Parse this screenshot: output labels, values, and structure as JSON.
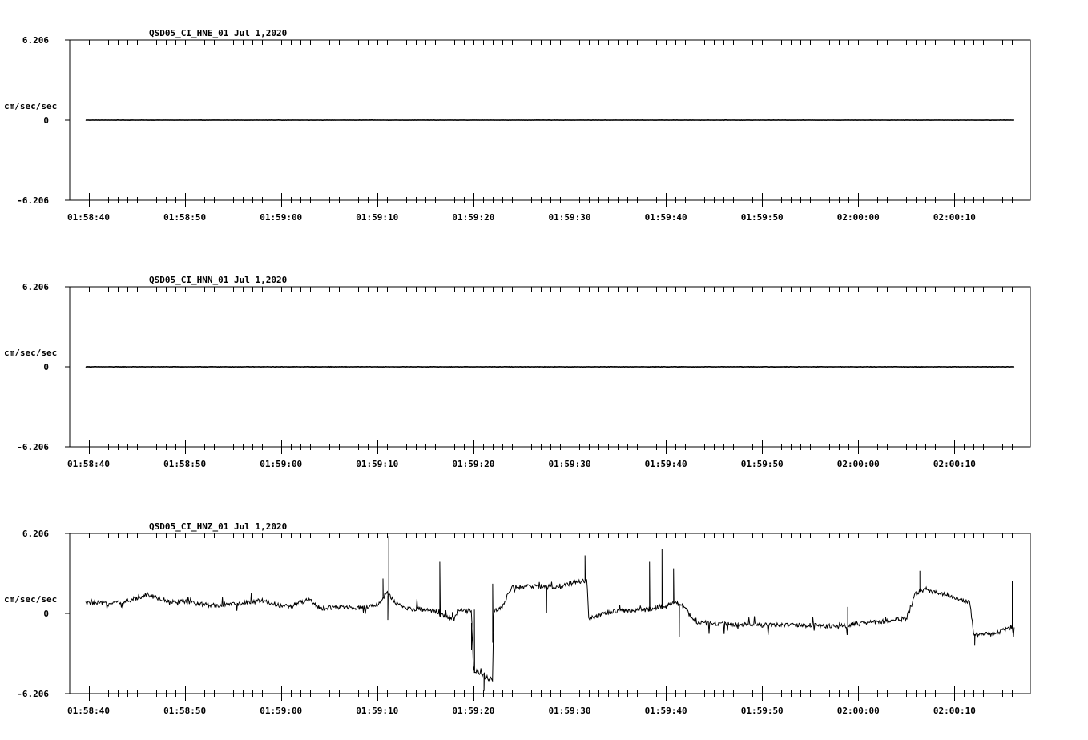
{
  "chart_data": [
    {
      "type": "line",
      "title": "QSD05_CI_HNE_01  Jul 1,2020",
      "ylabel": "cm/sec/sec",
      "ylim": [
        -6.206,
        6.206
      ],
      "ytick_labels": [
        "6.206",
        "0",
        "-6.206"
      ],
      "xtick_labels": [
        "01:58:40",
        "01:58:50",
        "01:59:00",
        "01:59:10",
        "01:59:20",
        "01:59:30",
        "01:59:40",
        "01:59:50",
        "02:00:00",
        "02:00:10"
      ],
      "xlim_seconds": [
        -1.8,
        90.2
      ],
      "data_range_seconds": [
        -0.3,
        96.2
      ],
      "series": [
        {
          "kind": "flat",
          "color": "#000000",
          "level": 0.0,
          "noise": 0.02
        }
      ]
    },
    {
      "type": "line",
      "title": "QSD05_CI_HNN_01  Jul 1,2020",
      "ylabel": "cm/sec/sec",
      "ylim": [
        -6.206,
        6.206
      ],
      "ytick_labels": [
        "6.206",
        "0",
        "-6.206"
      ],
      "xtick_labels": [
        "01:58:40",
        "01:58:50",
        "01:59:00",
        "01:59:10",
        "01:59:20",
        "01:59:30",
        "01:59:40",
        "01:59:50",
        "02:00:00",
        "02:00:10"
      ],
      "xlim_seconds": [
        -1.8,
        90.2
      ],
      "data_range_seconds": [
        -0.3,
        96.2
      ],
      "series": [
        {
          "kind": "flat",
          "color": "#000000",
          "level": 0.0,
          "noise": 0.03
        }
      ]
    },
    {
      "type": "line",
      "title": "QSD05_CI_HNZ_01  Jul 1,2020",
      "ylabel": "cm/sec/sec",
      "ylim": [
        -6.206,
        6.206
      ],
      "ytick_labels": [
        "6.206",
        "0",
        "-6.206"
      ],
      "xtick_labels": [
        "01:58:40",
        "01:58:50",
        "01:59:00",
        "01:59:10",
        "01:59:20",
        "01:59:30",
        "01:59:40",
        "01:59:50",
        "02:00:00",
        "02:00:10"
      ],
      "xlim_seconds": [
        -1.8,
        90.2
      ],
      "data_range_seconds": [
        -0.3,
        96.2
      ],
      "series": [
        {
          "kind": "trace",
          "color": "#000000",
          "noise": 0.18,
          "points": [
            [
              -0.3,
              0.8
            ],
            [
              2,
              0.8
            ],
            [
              4,
              0.9
            ],
            [
              6,
              1.5
            ],
            [
              8,
              1.0
            ],
            [
              10,
              0.9
            ],
            [
              12,
              0.7
            ],
            [
              14,
              0.6
            ],
            [
              16,
              0.8
            ],
            [
              18,
              1.0
            ],
            [
              20,
              0.6
            ],
            [
              21,
              0.5
            ],
            [
              22,
              0.9
            ],
            [
              23,
              1.0
            ],
            [
              24,
              0.4
            ],
            [
              26,
              0.5
            ],
            [
              28,
              0.4
            ],
            [
              30,
              0.6
            ],
            [
              31,
              1.6
            ],
            [
              32,
              0.7
            ],
            [
              33,
              0.4
            ],
            [
              35,
              0.3
            ],
            [
              36,
              0.2
            ],
            [
              37,
              -0.3
            ],
            [
              38,
              -0.4
            ],
            [
              38.5,
              0.2
            ],
            [
              39.8,
              0.2
            ],
            [
              40,
              -4.4
            ],
            [
              41,
              -4.8
            ],
            [
              42,
              -5.2
            ],
            [
              42.1,
              0.1
            ],
            [
              43,
              0.6
            ],
            [
              44,
              2.0
            ],
            [
              46,
              2.1
            ],
            [
              48,
              2.0
            ],
            [
              50,
              2.3
            ],
            [
              51,
              2.5
            ],
            [
              51.8,
              2.5
            ],
            [
              52,
              -0.4
            ],
            [
              54,
              0.1
            ],
            [
              56,
              0.2
            ],
            [
              58,
              0.3
            ],
            [
              60,
              0.6
            ],
            [
              61,
              0.9
            ],
            [
              62,
              0.4
            ],
            [
              63,
              -0.7
            ],
            [
              66,
              -0.8
            ],
            [
              70,
              -0.9
            ],
            [
              74,
              -0.9
            ],
            [
              78,
              -1.0
            ],
            [
              80,
              -0.8
            ],
            [
              83,
              -0.6
            ],
            [
              85,
              -0.4
            ],
            [
              86,
              1.6
            ],
            [
              87,
              1.9
            ],
            [
              88,
              1.6
            ],
            [
              90,
              1.3
            ],
            [
              91,
              0.9
            ],
            [
              91.6,
              0.9
            ],
            [
              92,
              -1.7
            ],
            [
              94,
              -1.6
            ],
            [
              95,
              -1.3
            ],
            [
              96.2,
              -1.0
            ]
          ],
          "spikes": [
            [
              31.2,
              6.0
            ],
            [
              31.1,
              -0.5
            ],
            [
              30.6,
              2.7
            ],
            [
              39.8,
              -2.8
            ],
            [
              40.1,
              0.3
            ],
            [
              41.1,
              -6.0
            ],
            [
              41.6,
              -5.1
            ],
            [
              42.0,
              2.3
            ],
            [
              47.6,
              0.0
            ],
            [
              51.6,
              4.5
            ],
            [
              58.3,
              4.0
            ],
            [
              59.6,
              5.0
            ],
            [
              60.8,
              3.5
            ],
            [
              61.4,
              -1.8
            ],
            [
              78.9,
              0.5
            ],
            [
              86.4,
              3.3
            ],
            [
              96.0,
              2.5
            ],
            [
              92.1,
              -2.5
            ],
            [
              36.5,
              4.0
            ],
            [
              37.8,
              0.1
            ]
          ]
        }
      ]
    }
  ]
}
